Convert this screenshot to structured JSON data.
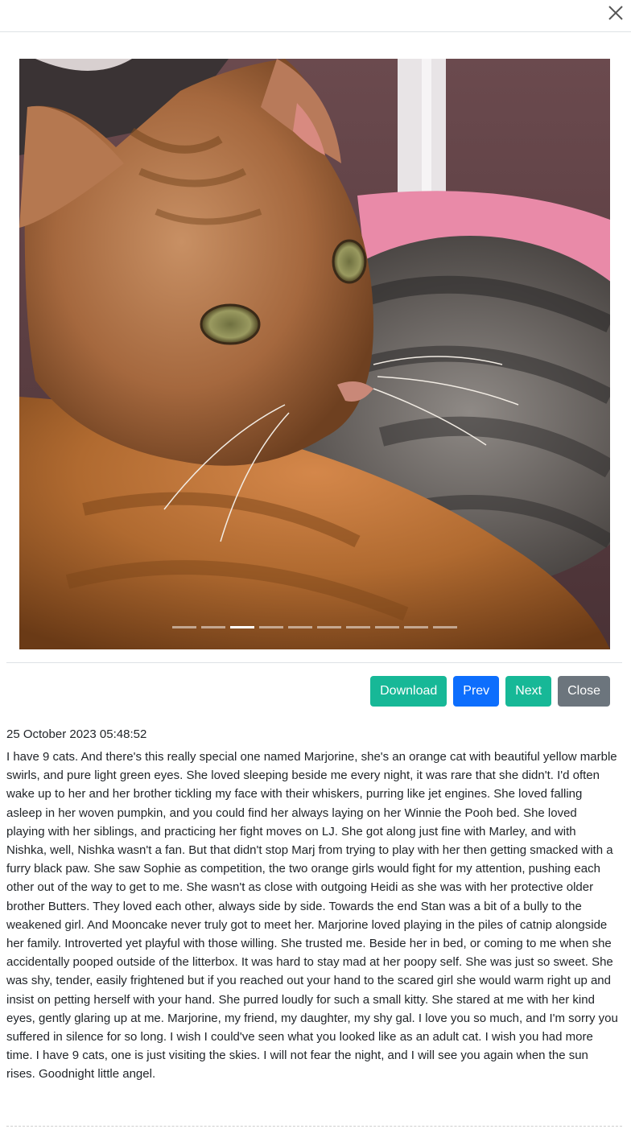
{
  "header": {
    "close_icon": "close-icon"
  },
  "carousel": {
    "image_subject": "orange tabby kitten resting on a grey tabby cat",
    "slide_count": 10,
    "active_index": 2
  },
  "actions": {
    "download_label": "Download",
    "prev_label": "Prev",
    "next_label": "Next",
    "close_label": "Close"
  },
  "post": {
    "timestamp": "25 October 2023 05:48:52",
    "text": "I have 9 cats. And there's this really special one named Marjorine, she's an orange cat with beautiful yellow marble swirls, and pure light green eyes. She loved sleeping beside me every night, it was rare that she didn't. I'd often wake up to her and her brother tickling my face with their whiskers, purring like jet engines. She loved falling asleep in her woven pumpkin, and you could find her always laying on her Winnie the Pooh bed. She loved playing with her siblings, and practicing her fight moves on LJ. She got along just fine with Marley, and with Nishka, well, Nishka wasn't a fan. But that didn't stop Marj from trying to play with her then getting smacked with a furry black paw. She saw Sophie as competition, the two orange girls would fight for my attention, pushing each other out of the way to get to me. She wasn't as close with outgoing Heidi as she was with her protective older brother Butters. They loved each other, always side by side. Towards the end Stan was a bit of a bully to the weakened girl. And Mooncake never truly got to meet her. Marjorine loved playing in the piles of catnip alongside her family. Introverted yet playful with those willing. She trusted me. Beside her in bed, or coming to me when she accidentally pooped outside of the litterbox. It was hard to stay mad at her poopy self. She was just so sweet. She was shy, tender, easily frightened but if you reached out your hand to the scared girl she would warm right up and insist on petting herself with your hand. She purred loudly for such a small kitty. She stared at me with her kind eyes, gently glaring up at me. Marjorine, my friend, my daughter, my shy gal. I love you so much, and I'm sorry you suffered in silence for so long. I wish I could've seen what you looked like as an adult cat. I wish you had more time. I have 9 cats, one is just visiting the skies. I will not fear the night, and I will see you again when the sun rises. Goodnight little angel."
  },
  "colors": {
    "download": "#17b897",
    "prev": "#0d6efd",
    "next": "#17b897",
    "close": "#6c757d"
  }
}
